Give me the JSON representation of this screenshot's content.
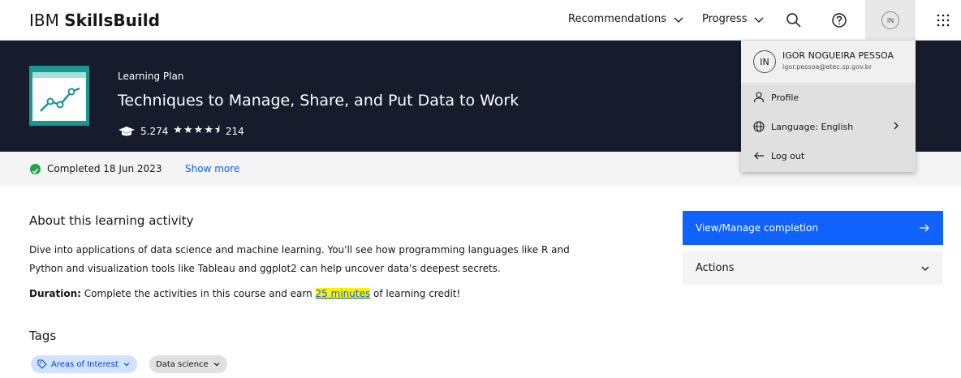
{
  "brand": {
    "prefix": "IBM",
    "name": "SkillsBuild"
  },
  "nav": {
    "recommendations": "Recommendations",
    "progress": "Progress",
    "avatar_initials": "IN"
  },
  "hero": {
    "label": "Learning Plan",
    "title": "Techniques to Manage, Share, and Put Data to Work",
    "learners": "5.274",
    "rating_count": "214",
    "rating_stars": 4.5
  },
  "completion": {
    "status": "Completed 18 Jun 2023",
    "show_more": "Show more"
  },
  "about": {
    "heading": "About this learning activity",
    "description": "Dive into applications of data science and machine learning. You'll see how programming languages like R and Python and visualization tools like Tableau and ggplot2 can help uncover data's deepest secrets.",
    "duration_label": "Duration:",
    "duration_pre": "Complete the activities in this course and earn",
    "duration_highlight": "25 minutes",
    "duration_post": "of learning credit!"
  },
  "tags": {
    "heading": "Tags",
    "items": [
      {
        "label": "Areas of Interest"
      },
      {
        "label": "Data science"
      }
    ]
  },
  "sidebar": {
    "view_manage": "View/Manage completion",
    "actions": "Actions"
  },
  "profile_menu": {
    "initials": "IN",
    "name": "IGOR NOGUEIRA PESSOA",
    "email": "igor.pessoa@etec.sp.gov.br",
    "profile": "Profile",
    "language": "Language: English",
    "logout": "Log out"
  },
  "colors": {
    "hero_bg": "#161c2b",
    "accent_blue": "#0f62fe",
    "thumbnail_teal": "#1a9690",
    "success_green": "#24a148",
    "highlight_yellow": "#fff200"
  }
}
